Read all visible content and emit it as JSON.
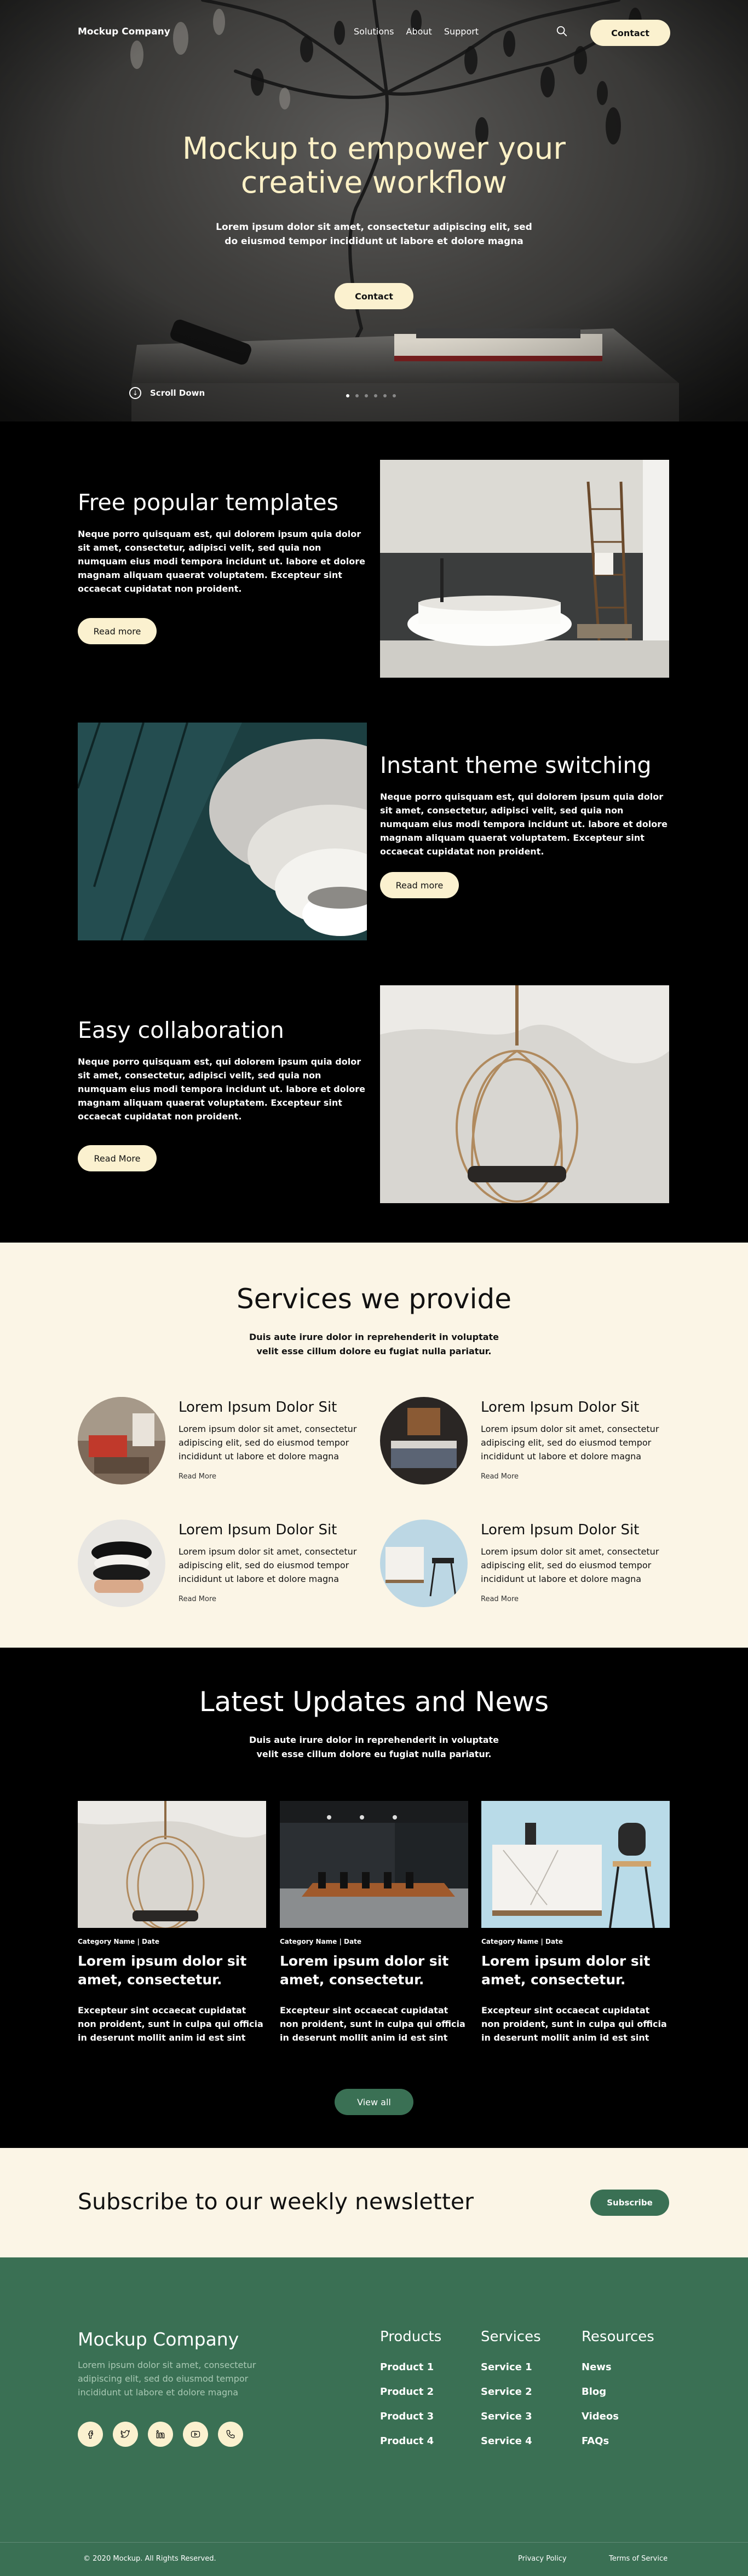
{
  "header": {
    "logo": "Mockup Company",
    "nav": [
      "Solutions",
      "About",
      "Support"
    ],
    "contact_label": "Contact"
  },
  "hero": {
    "title": "Mockup to empower your creative workflow",
    "subtitle": "Lorem ipsum dolor sit amet, consectetur adipiscing elit, sed do eiusmod tempor incididunt ut labore et dolore magna",
    "cta_label": "Contact",
    "scroll_label": "Scroll Down",
    "slides_count": 6,
    "active_slide": 1
  },
  "features": [
    {
      "title": "Free popular templates",
      "text": "Neque porro quisquam est, qui dolorem ipsum quia dolor sit amet, consectetur, adipisci velit, sed quia non numquam eius modi tempora incidunt ut. labore et dolore magnam aliquam quaerat voluptatem. Excepteur sint occaecat cupidatat non proident.",
      "button": "Read more",
      "image": "bathroom-photo"
    },
    {
      "title": "Instant theme switching",
      "text": "Neque porro quisquam est, qui dolorem ipsum quia dolor sit amet, consectetur, adipisci velit, sed quia non numquam eius modi tempora incidunt ut. labore et dolore magnam aliquam quaerat voluptatem. Excepteur sint occaecat cupidatat non proident.",
      "button": "Read more",
      "image": "pendant-lamp-photo"
    },
    {
      "title": "Easy collaboration",
      "text": "Neque porro quisquam est, qui dolorem ipsum quia dolor sit amet, consectetur, adipisci velit, sed quia non numquam eius modi tempora incidunt ut. labore et dolore magnam aliquam quaerat voluptatem. Excepteur sint occaecat cupidatat non proident.",
      "button": "Read More",
      "image": "hanging-chair-photo"
    }
  ],
  "services": {
    "title": "Services we provide",
    "subtitle": "Duis aute irure dolor in reprehenderit in voluptate velit esse cillum dolore eu fugiat nulla pariatur.",
    "items": [
      {
        "title": "Lorem Ipsum Dolor Sit",
        "text": "Lorem ipsum dolor sit amet, consectetur adipiscing elit, sed do eiusmod tempor incididunt ut labore et dolore magna",
        "link": "Read More"
      },
      {
        "title": "Lorem Ipsum Dolor Sit",
        "text": "Lorem ipsum dolor sit amet, consectetur adipiscing elit, sed do eiusmod tempor incididunt ut labore et dolore magna",
        "link": "Read More"
      },
      {
        "title": "Lorem Ipsum Dolor Sit",
        "text": "Lorem ipsum dolor sit amet, consectetur adipiscing elit, sed do eiusmod tempor incididunt ut labore et dolore magna",
        "link": "Read More"
      },
      {
        "title": "Lorem Ipsum Dolor Sit",
        "text": "Lorem ipsum dolor sit amet, consectetur adipiscing elit, sed do eiusmod tempor incididunt ut labore et dolore magna",
        "link": "Read More"
      }
    ]
  },
  "news": {
    "title": "Latest Updates and News",
    "subtitle": "Duis aute irure dolor in reprehenderit in voluptate velit esse cillum dolore eu fugiat nulla pariatur.",
    "cards": [
      {
        "meta": "Category Name  |  Date",
        "title": "Lorem ipsum dolor sit amet, consectetur.",
        "text": "Excepteur sint occaecat cupidatat non proident, sunt in culpa qui officia in deserunt mollit anim id est sint"
      },
      {
        "meta": "Category Name  |  Date",
        "title": "Lorem ipsum dolor sit amet, consectetur.",
        "text": "Excepteur sint occaecat cupidatat non proident, sunt in culpa qui officia in deserunt mollit anim id est sint"
      },
      {
        "meta": "Category Name  |  Date",
        "title": "Lorem ipsum dolor sit amet, consectetur.",
        "text": "Excepteur sint occaecat cupidatat non proident, sunt in culpa qui officia in deserunt mollit anim id est sint"
      }
    ],
    "view_all": "View all"
  },
  "newsletter": {
    "title": "Subscribe to our weekly newsletter",
    "button": "Subscribe"
  },
  "footer": {
    "brand": "Mockup Company",
    "description": "Lorem ipsum dolor sit amet, consectetur adipiscing elit, sed do eiusmod tempor incididunt ut labore et dolore magna",
    "socials": [
      "facebook-icon",
      "twitter-icon",
      "linkedin-icon",
      "youtube-icon",
      "phone-icon"
    ],
    "columns": [
      {
        "title": "Products",
        "links": [
          "Product 1",
          "Product 2",
          "Product 3",
          "Product 4"
        ]
      },
      {
        "title": "Services",
        "links": [
          "Service 1",
          "Service 2",
          "Service 3",
          "Service 4"
        ]
      },
      {
        "title": "Resources",
        "links": [
          "News",
          "Blog",
          "Videos",
          "FAQs"
        ]
      }
    ],
    "copyright": "© 2020 Mockup.  All Rights Reserved.",
    "privacy": "Privacy Policy",
    "terms": "Terms of Service"
  },
  "colors": {
    "cream": "#fbf1cf",
    "cream_bg": "#fbf5e6",
    "green": "#3a7054",
    "hero_title": "#fdf1c6"
  }
}
